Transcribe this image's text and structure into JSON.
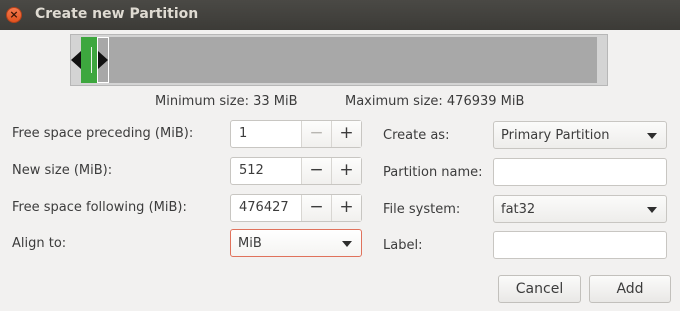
{
  "window": {
    "title": "Create new Partition",
    "close_glyph": "×"
  },
  "partition_bar": {
    "partition_color": "#3da73e",
    "free_color": "#a8a8a8",
    "new_size_mib": 512,
    "total_mib": 476939
  },
  "sizes": {
    "minimum": "Minimum size: 33 MiB",
    "maximum": "Maximum size: 476939 MiB"
  },
  "left_form": {
    "free_preceding": {
      "label": "Free space preceding (MiB):",
      "value": "1"
    },
    "new_size": {
      "label": "New size (MiB):",
      "value": "512"
    },
    "free_following": {
      "label": "Free space following (MiB):",
      "value": "476427"
    },
    "align_to": {
      "label": "Align to:",
      "value": "MiB"
    },
    "minus_glyph": "−",
    "plus_glyph": "+"
  },
  "right_form": {
    "create_as": {
      "label": "Create as:",
      "value": "Primary Partition"
    },
    "partition_name": {
      "label": "Partition name:",
      "value": ""
    },
    "file_system": {
      "label": "File system:",
      "value": "fat32"
    },
    "label": {
      "label": "Label:",
      "value": ""
    }
  },
  "buttons": {
    "cancel": "Cancel",
    "add": "Add"
  },
  "colors": {
    "titlebar": "#3c3b37",
    "close": "#e95420",
    "focus": "#e0725c"
  }
}
